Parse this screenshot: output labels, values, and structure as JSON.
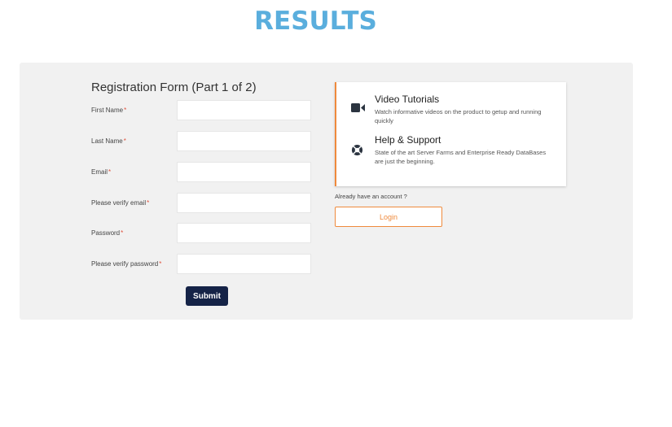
{
  "page": {
    "heading": "RESULTS"
  },
  "form": {
    "title": "Registration Form (Part 1 of 2)",
    "required_marker": "*",
    "fields": [
      {
        "label": "First Name",
        "value": "",
        "placeholder": ""
      },
      {
        "label": "Last Name",
        "value": "",
        "placeholder": ""
      },
      {
        "label": "Email",
        "value": "",
        "placeholder": ""
      },
      {
        "label": "Please verify email",
        "value": "",
        "placeholder": ""
      },
      {
        "label": "Password",
        "value": "",
        "placeholder": ""
      },
      {
        "label": "Please verify password",
        "value": "",
        "placeholder": ""
      }
    ],
    "submit_label": "Submit"
  },
  "info": {
    "items": [
      {
        "icon": "video-camera-icon",
        "title": "Video Tutorials",
        "description": "Watch informative videos on the product to getup and running quickly"
      },
      {
        "icon": "lifebuoy-icon",
        "title": "Help & Support",
        "description": "State of the art Server Farms and Enterprise Ready DataBases are just the beginning."
      }
    ]
  },
  "account": {
    "prompt": "Already have an account ?",
    "login_label": "Login"
  },
  "colors": {
    "heading": "#5aaedd",
    "panel_bg": "#f1f1f1",
    "submit_bg": "#152347",
    "accent_orange": "#ef8a3c",
    "required": "#e0533f"
  }
}
